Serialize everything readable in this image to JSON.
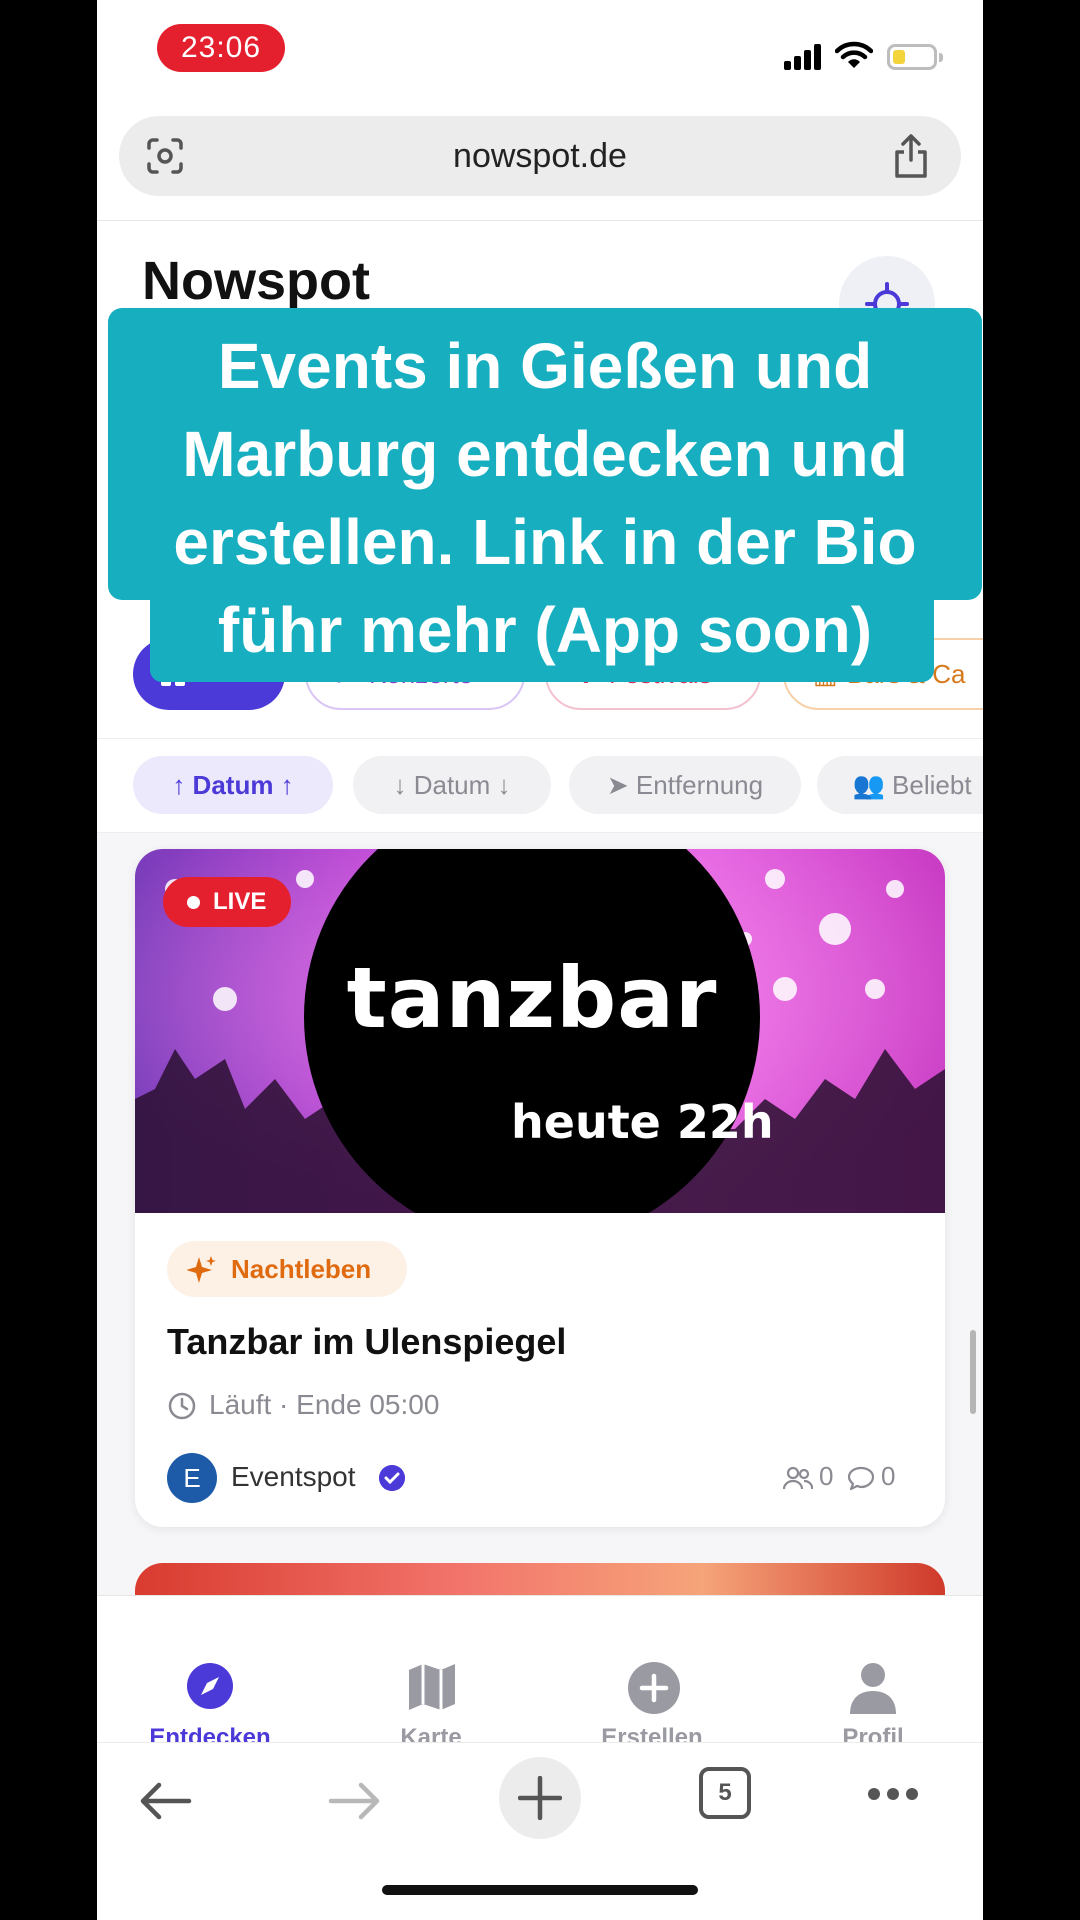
{
  "status": {
    "time": "23:06"
  },
  "browser": {
    "url": "nowspot.de",
    "tab_count": "5"
  },
  "app": {
    "title": "Nowspot"
  },
  "categories": [
    {
      "label": "Alle"
    },
    {
      "label": "Konzerte"
    },
    {
      "label": "Festivals"
    },
    {
      "label": "Bars & Ca"
    }
  ],
  "sort": [
    {
      "label": "↑ Datum ↑"
    },
    {
      "label": "↓ Datum ↓"
    },
    {
      "label": "Entfernung"
    },
    {
      "label": "Beliebt"
    }
  ],
  "event": {
    "live_label": "LIVE",
    "image_title": "tanzbar",
    "image_subtitle": "heute 22h",
    "category": "Nachtleben",
    "title": "Tanzbar im Ulenspiegel",
    "time": "Läuft · Ende 05:00",
    "organizer_initial": "E",
    "organizer": "Eventspot",
    "participants": "0",
    "comments": "0"
  },
  "tabs": [
    {
      "label": "Entdecken"
    },
    {
      "label": "Karte"
    },
    {
      "label": "Erstellen"
    },
    {
      "label": "Profil"
    }
  ],
  "overlay": {
    "caption": "Events in Gießen und Marburg entdecken und erstellen. Link in der Bio führ mehr (App soon)"
  },
  "colors": {
    "accent": "#4b39d8",
    "live": "#e5202e",
    "caption_bg": "#17aec0"
  }
}
